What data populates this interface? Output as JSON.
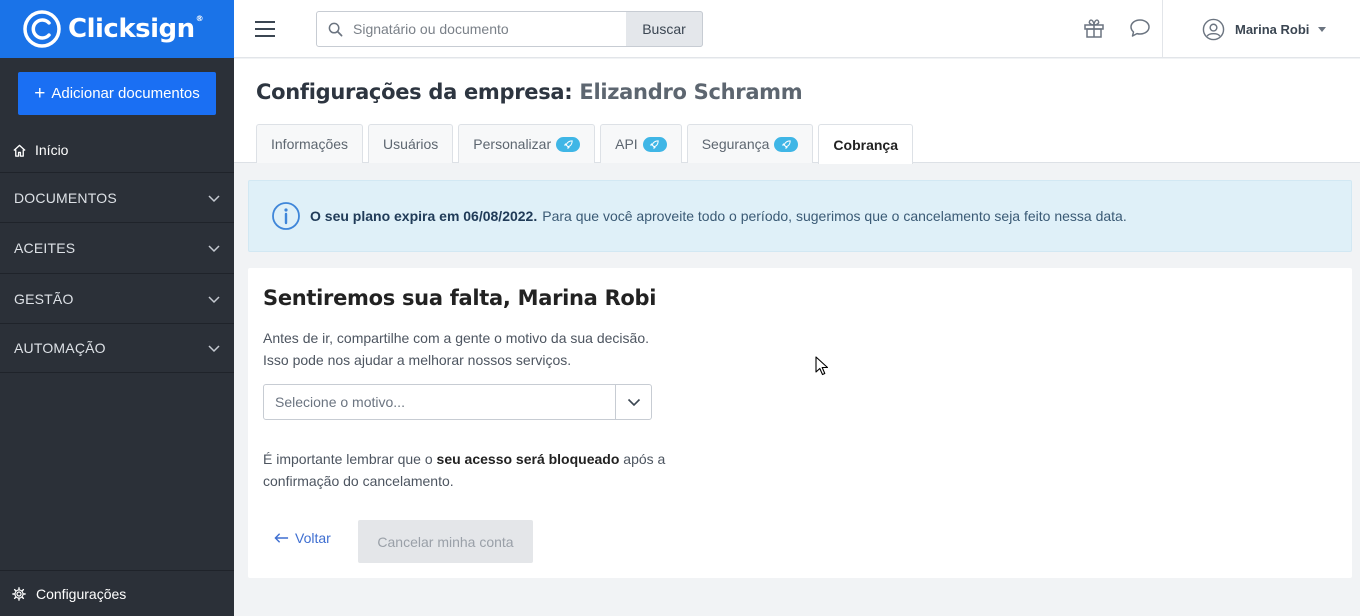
{
  "brand": {
    "name": "Clicksign",
    "trademark": "®"
  },
  "sidebar": {
    "add_button": "Adicionar documentos",
    "home": "Início",
    "sections": [
      "DOCUMENTOS",
      "ACEITES",
      "GESTÃO",
      "AUTOMAÇÃO"
    ],
    "settings": "Configurações"
  },
  "topbar": {
    "search_placeholder": "Signatário ou documento",
    "search_button": "Buscar",
    "user_name": "Marina Robi"
  },
  "page": {
    "title_prefix": "Configurações da empresa:",
    "company": "Elizandro Schramm",
    "tabs": [
      {
        "label": "Informações",
        "badge": false,
        "active": false
      },
      {
        "label": "Usuários",
        "badge": false,
        "active": false
      },
      {
        "label": "Personalizar",
        "badge": true,
        "active": false
      },
      {
        "label": "API",
        "badge": true,
        "active": false
      },
      {
        "label": "Segurança",
        "badge": true,
        "active": false
      },
      {
        "label": "Cobrança",
        "badge": false,
        "active": true
      }
    ]
  },
  "alert": {
    "strong": "O seu plano expira em 06/08/2022.",
    "text": "Para que você aproveite todo o período, sugerimos que o cancelamento seja feito nessa data."
  },
  "card": {
    "title": "Sentiremos sua falta, Marina Robi",
    "desc_line1": "Antes de ir, compartilhe com a gente o motivo da sua decisão.",
    "desc_line2": "Isso pode nos ajudar a melhorar nossos serviços.",
    "select_placeholder": "Selecione o motivo...",
    "warning_before": "É importante lembrar que o ",
    "warning_bold": "seu acesso será bloqueado",
    "warning_after": " após a confirmação do cancelamento.",
    "back_label": "Voltar",
    "cancel_label": "Cancelar minha conta"
  },
  "colors": {
    "brand_blue": "#1a73e8",
    "sidebar_bg": "#2b3038",
    "alert_bg": "#dff0f8",
    "badge": "#3fb6e6"
  }
}
